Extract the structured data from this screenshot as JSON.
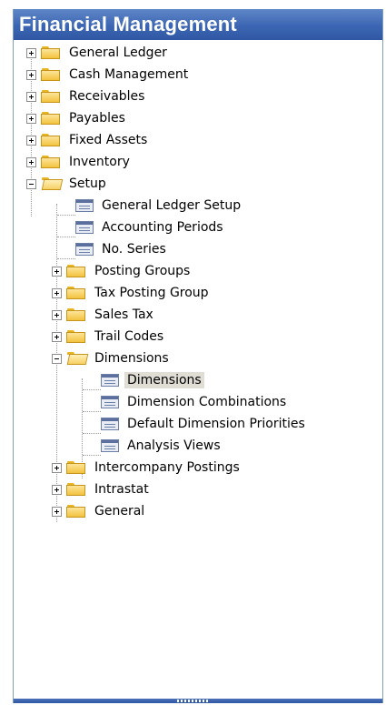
{
  "panel": {
    "title": "Financial Management",
    "colors": {
      "title_bar": "#3c66b3",
      "folder": "#f2c33e",
      "selection": "#e0ddd5"
    }
  },
  "tree": {
    "top": [
      {
        "label": "General Ledger",
        "state": "collapsed",
        "icon": "folder-icon"
      },
      {
        "label": "Cash Management",
        "state": "collapsed",
        "icon": "folder-icon"
      },
      {
        "label": "Receivables",
        "state": "collapsed",
        "icon": "folder-icon"
      },
      {
        "label": "Payables",
        "state": "collapsed",
        "icon": "folder-icon"
      },
      {
        "label": "Fixed Assets",
        "state": "collapsed",
        "icon": "folder-icon"
      },
      {
        "label": "Inventory",
        "state": "collapsed",
        "icon": "folder-icon"
      },
      {
        "label": "Setup",
        "state": "expanded",
        "icon": "open-folder-icon"
      }
    ],
    "setup": [
      {
        "label": "General Ledger Setup",
        "icon": "form-icon"
      },
      {
        "label": "Accounting Periods",
        "icon": "form-icon"
      },
      {
        "label": "No. Series",
        "icon": "form-icon"
      },
      {
        "label": "Posting Groups",
        "state": "collapsed",
        "icon": "folder-icon"
      },
      {
        "label": "Tax Posting Group",
        "state": "collapsed",
        "icon": "folder-icon"
      },
      {
        "label": "Sales Tax",
        "state": "collapsed",
        "icon": "folder-icon"
      },
      {
        "label": "Trail Codes",
        "state": "collapsed",
        "icon": "folder-icon"
      },
      {
        "label": "Dimensions",
        "state": "expanded",
        "icon": "open-folder-icon"
      },
      {
        "label": "Intercompany Postings",
        "state": "collapsed",
        "icon": "folder-icon"
      },
      {
        "label": "Intrastat",
        "state": "collapsed",
        "icon": "folder-icon"
      },
      {
        "label": "General",
        "state": "collapsed",
        "icon": "folder-icon"
      }
    ],
    "dimensions": [
      {
        "label": "Dimensions",
        "icon": "form-icon",
        "selected": true
      },
      {
        "label": "Dimension Combinations",
        "icon": "form-icon"
      },
      {
        "label": "Default Dimension Priorities",
        "icon": "form-icon"
      },
      {
        "label": "Analysis Views",
        "icon": "form-icon"
      }
    ]
  }
}
